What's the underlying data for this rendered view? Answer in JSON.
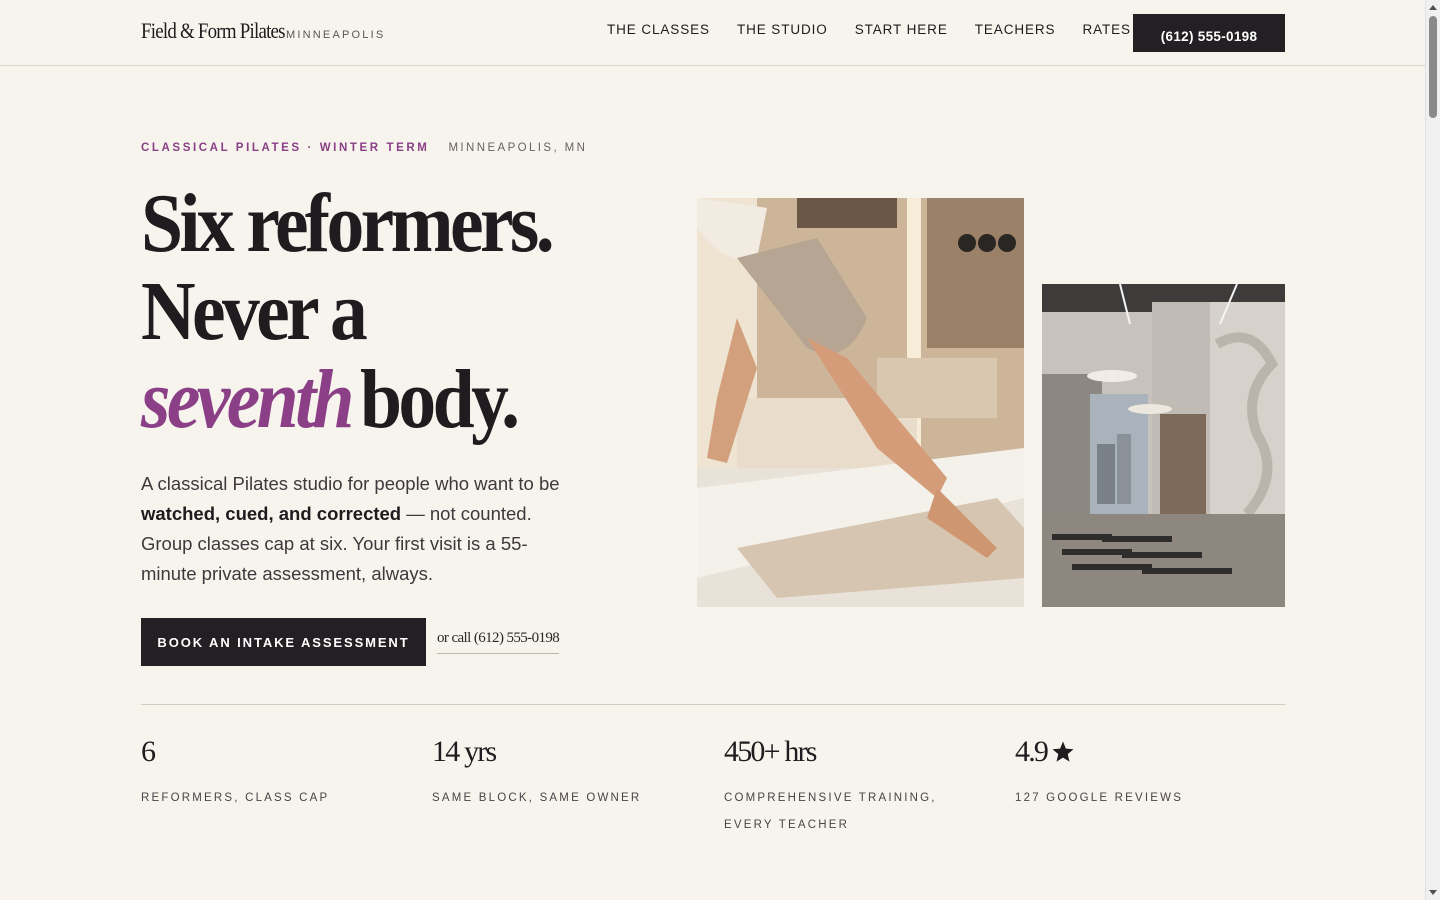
{
  "header": {
    "brand_name": "Field & Form Pilates",
    "brand_city": "MINNEAPOLIS",
    "nav": [
      "THE CLASSES",
      "THE STUDIO",
      "START HERE",
      "TEACHERS",
      "RATES"
    ],
    "phone_button": "(612) 555-0198"
  },
  "hero": {
    "eyebrow_accent": "CLASSICAL PILATES · WINTER TERM",
    "eyebrow_location": "MINNEAPOLIS, MN",
    "headline_line1": "Six reformers.",
    "headline_line2": "Never a",
    "headline_accent": "seventh",
    "headline_line3_rest": "body.",
    "lede_start": "A classical Pilates studio for people who want to be ",
    "lede_bold": "watched, cued, and corrected",
    "lede_end": " — not counted. Group classes cap at six. Your first visit is a 55-minute private assessment, always.",
    "cta_label": "BOOK AN INTAKE ASSESSMENT",
    "alt_call": "or call (612) 555-0198"
  },
  "stats": [
    {
      "value": "6",
      "label": "REFORMERS, CLASS CAP"
    },
    {
      "value": "14 yrs",
      "label": "SAME BLOCK, SAME OWNER"
    },
    {
      "value": "450+ hrs",
      "label": "COMPREHENSIVE TRAINING, EVERY TEACHER"
    },
    {
      "value": "4.9",
      "label": "127 GOOGLE REVIEWS",
      "icon": "star-icon"
    }
  ],
  "colors": {
    "background": "#f7f4ee",
    "accent": "#8a3f86",
    "dark": "#231f23"
  }
}
